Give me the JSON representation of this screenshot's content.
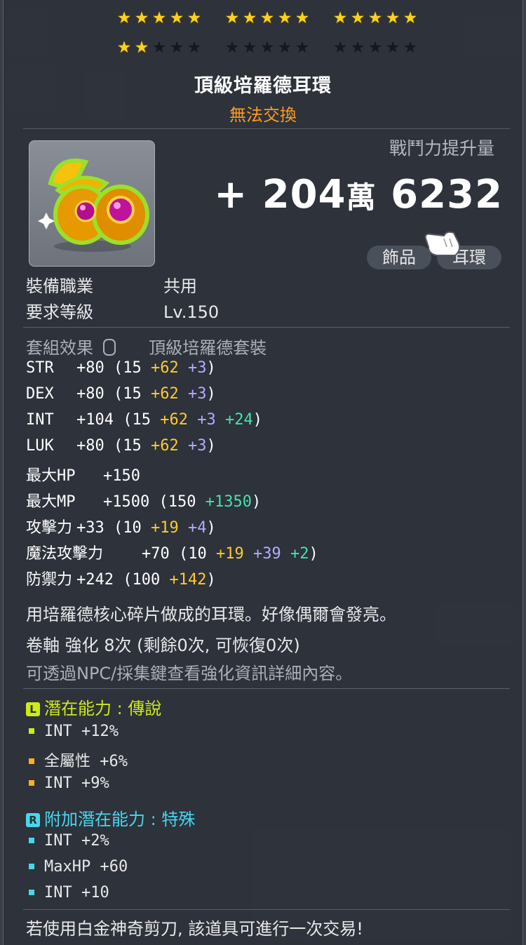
{
  "stars": {
    "row1": [
      5,
      5,
      5
    ],
    "row2": [
      2,
      0,
      0
    ]
  },
  "item": {
    "name": "頂級培羅德耳環",
    "trade_status": "無法交換"
  },
  "power": {
    "label": "戰鬥力提升量",
    "plus": "+",
    "num1": "204",
    "unit": "萬",
    "num2": "6232"
  },
  "tags": [
    "飾品",
    "耳環"
  ],
  "info": {
    "job_label": "裝備職業",
    "job_value": "共用",
    "level_label": "要求等級",
    "level_value": "Lv.150"
  },
  "set": {
    "label": "套組效果",
    "name": "頂級培羅德套裝"
  },
  "stats": [
    {
      "name": "STR",
      "total": "+80",
      "base": "15",
      "extra": [
        [
          "y",
          "+62"
        ],
        [
          "p",
          "+3"
        ]
      ]
    },
    {
      "name": "DEX",
      "total": "+80",
      "base": "15",
      "extra": [
        [
          "y",
          "+62"
        ],
        [
          "p",
          "+3"
        ]
      ]
    },
    {
      "name": "INT",
      "total": "+104",
      "base": "15",
      "extra": [
        [
          "y",
          "+62"
        ],
        [
          "p",
          "+3"
        ],
        [
          "g",
          "+24"
        ]
      ]
    },
    {
      "name": "LUK",
      "total": "+80",
      "base": "15",
      "extra": [
        [
          "y",
          "+62"
        ],
        [
          "p",
          "+3"
        ]
      ]
    },
    {
      "name": "最大HP",
      "total": "+150",
      "base": "",
      "extra": []
    },
    {
      "name": "最大MP",
      "total": "+1500",
      "base": "150",
      "extra": [
        [
          "g",
          "+1350"
        ]
      ]
    },
    {
      "name": "攻擊力",
      "total": "+33",
      "base": "10",
      "extra": [
        [
          "y",
          "+19"
        ],
        [
          "p",
          "+4"
        ]
      ]
    },
    {
      "name": "魔法攻擊力",
      "total": "+70",
      "base": "10",
      "extra": [
        [
          "y",
          "+19"
        ],
        [
          "p",
          "+39"
        ],
        [
          "g",
          "+2"
        ]
      ]
    },
    {
      "name": "防禦力",
      "total": "+242",
      "base": "100",
      "extra": [
        [
          "y",
          "+142"
        ]
      ]
    }
  ],
  "description": "用培羅德核心碎片做成的耳環。好像偶爾會發亮。",
  "scroll": "卷軸 強化 8次 (剩餘0次, 可恢復0次)",
  "npc_hint": "可透過NPC/採集鍵查看強化資訊詳細內容。",
  "potential": {
    "badge": "L",
    "title": "潛在能力 : 傳說",
    "lines": [
      "INT +12%",
      "全屬性 +6%",
      "INT +9%"
    ],
    "bullet_colors": [
      "#cdea19",
      "#ffb020",
      "#ffb020"
    ]
  },
  "bonus_potential": {
    "badge": "R",
    "title": "附加潛在能力 : 特殊",
    "lines": [
      "INT +2%",
      "MaxHP +60",
      "INT +10"
    ],
    "bullet_colors": [
      "#47d7ec",
      "#47d7ec",
      "#47d7ec"
    ]
  },
  "footer": "若使用白金神奇剪刀, 該道具可進行一次交易!",
  "colors": {
    "title": "#ffffff",
    "trade": "#ff9c1a",
    "legendary": "#cdea19",
    "rare": "#47d7ec",
    "star": "#ffd21a"
  }
}
